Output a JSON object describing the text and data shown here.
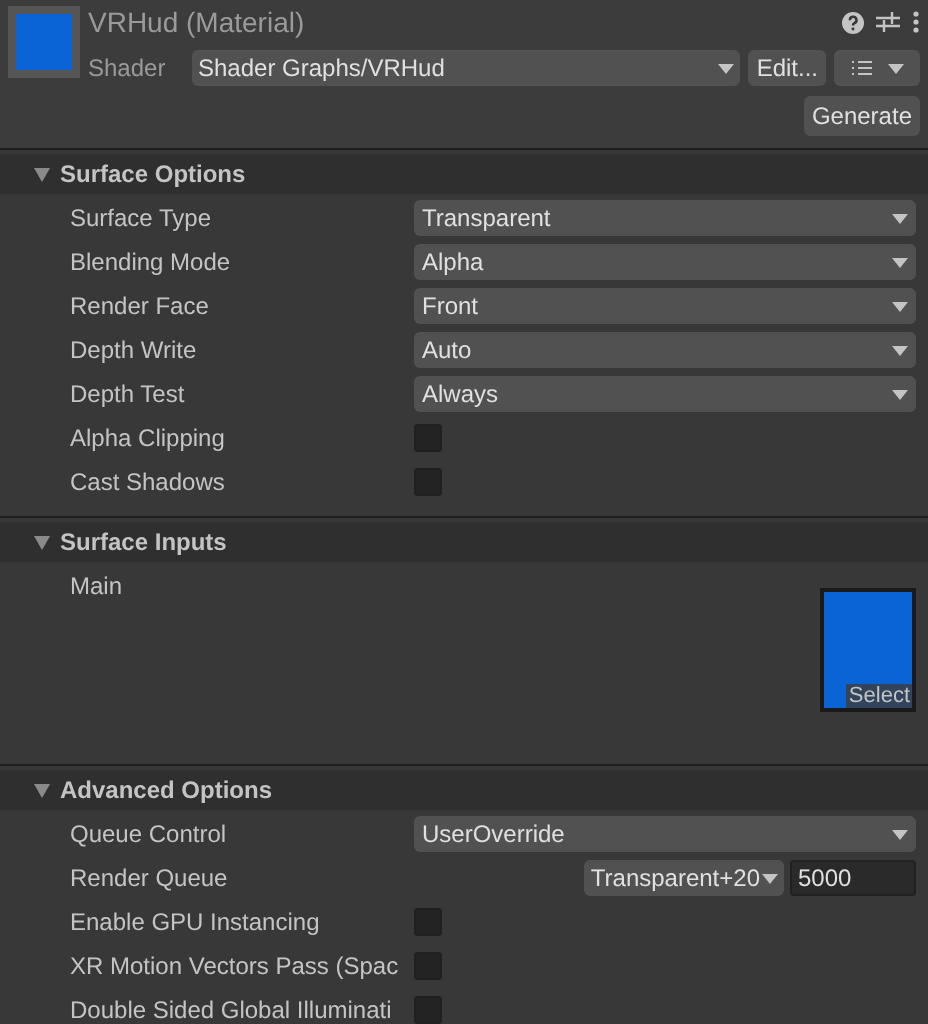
{
  "header": {
    "title": "VRHud (Material)",
    "shader_label": "Shader",
    "shader": "Shader Graphs/VRHud",
    "edit_button": "Edit...",
    "generate_button": "Generate"
  },
  "sections": [
    {
      "title": "Surface Options",
      "expanded": true,
      "rows": [
        {
          "kind": "dropdown",
          "label": "Surface Type",
          "value": "Transparent"
        },
        {
          "kind": "dropdown",
          "label": "Blending Mode",
          "value": "Alpha"
        },
        {
          "kind": "dropdown",
          "label": "Render Face",
          "value": "Front"
        },
        {
          "kind": "dropdown",
          "label": "Depth Write",
          "value": "Auto"
        },
        {
          "kind": "dropdown",
          "label": "Depth Test",
          "value": "Always"
        },
        {
          "kind": "checkbox",
          "label": "Alpha Clipping",
          "checked": false
        },
        {
          "kind": "checkbox",
          "label": "Cast Shadows",
          "checked": false
        }
      ]
    },
    {
      "title": "Surface Inputs",
      "expanded": true,
      "rows": [
        {
          "kind": "texture",
          "label": "Main",
          "button": "Select",
          "color": "#0a64d6"
        }
      ]
    },
    {
      "title": "Advanced Options",
      "expanded": true,
      "rows": [
        {
          "kind": "dropdown",
          "label": "Queue Control",
          "value": "UserOverride"
        },
        {
          "kind": "queue",
          "label": "Render Queue",
          "preset": "Transparent+20",
          "value": "5000"
        },
        {
          "kind": "checkbox",
          "label": "Enable GPU Instancing",
          "checked": false
        },
        {
          "kind": "checkbox",
          "label": "XR Motion Vectors Pass (Spac",
          "checked": false
        },
        {
          "kind": "checkbox",
          "label": "Double Sided Global Illuminati",
          "checked": false
        }
      ]
    }
  ]
}
